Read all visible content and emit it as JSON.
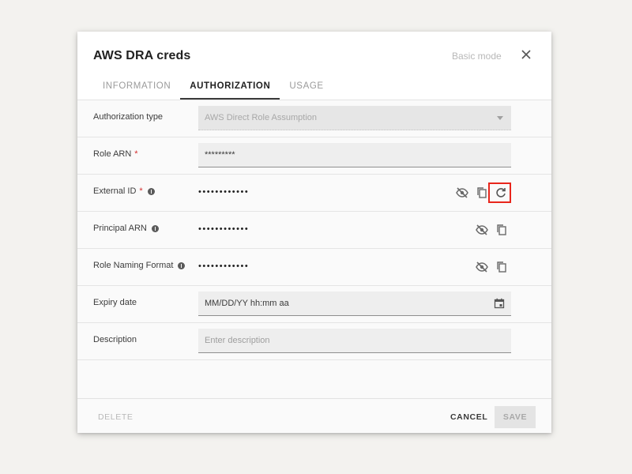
{
  "dialog": {
    "title": "AWS DRA creds",
    "basic_mode_label": "Basic mode"
  },
  "tabs": [
    {
      "label": "INFORMATION",
      "active": false
    },
    {
      "label": "AUTHORIZATION",
      "active": true
    },
    {
      "label": "USAGE",
      "active": false
    }
  ],
  "form": {
    "authorization_type": {
      "label": "Authorization type",
      "value": "AWS Direct Role Assumption"
    },
    "role_arn": {
      "label": "Role ARN",
      "required_mark": "*",
      "value": "*********"
    },
    "external_id": {
      "label": "External ID",
      "required_mark": "*",
      "value": "••••••••••••"
    },
    "principal_arn": {
      "label": "Principal ARN",
      "value": "••••••••••••"
    },
    "role_naming_format": {
      "label": "Role Naming Format",
      "value": "••••••••••••"
    },
    "expiry_date": {
      "label": "Expiry date",
      "placeholder": "MM/DD/YY hh:mm aa"
    },
    "description": {
      "label": "Description",
      "placeholder": "Enter description"
    }
  },
  "footer": {
    "delete_label": "DELETE",
    "cancel_label": "CANCEL",
    "save_label": "SAVE"
  },
  "icons": {
    "close": "close-icon",
    "hide": "eye-off-icon",
    "copy": "copy-icon",
    "refresh": "refresh-icon",
    "info": "info-icon",
    "calendar": "calendar-icon",
    "dropdown": "chevron-down-icon"
  },
  "colors": {
    "required": "#d32f2f",
    "highlight": "#e8261c",
    "active_tab": "#212121"
  }
}
